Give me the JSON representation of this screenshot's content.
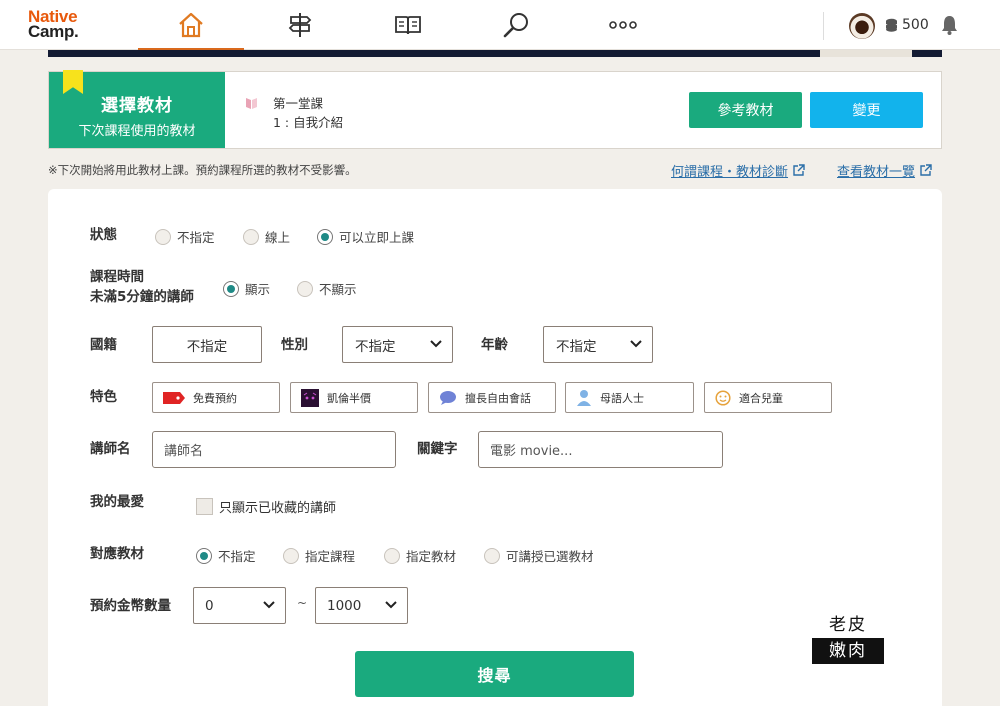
{
  "header": {
    "logo_line1": "Native",
    "logo_line2": "Camp.",
    "nav": [
      {
        "name": "home-icon",
        "active": true
      },
      {
        "name": "signpost-icon",
        "active": false
      },
      {
        "name": "book-icon",
        "active": false
      },
      {
        "name": "search-icon",
        "active": false
      },
      {
        "name": "more-icon",
        "active": false
      }
    ],
    "coins": "500"
  },
  "textbook": {
    "title": "選擇教材",
    "subtitle": "下次課程使用的教材",
    "lesson_line1": "第一堂課",
    "lesson_line2": "1 : 自我介紹",
    "ref_button": "參考教材",
    "change_button": "變更"
  },
  "note": "※下次開始將用此教材上課。預約課程所選的教材不受影響。",
  "links": {
    "diagnosis": "何謂課程・教材診斷",
    "list": "查看教材一覽"
  },
  "form": {
    "status": {
      "label": "狀態",
      "options": [
        "不指定",
        "線上",
        "可以立即上課"
      ],
      "selected": 2
    },
    "short_lesson": {
      "label_line1": "課程時間",
      "label_line2": "未滿5分鐘的講師",
      "options": [
        "顯示",
        "不顯示"
      ],
      "selected": 0
    },
    "nationality": {
      "label": "國籍",
      "value": "不指定"
    },
    "gender": {
      "label": "性別",
      "value": "不指定"
    },
    "age": {
      "label": "年齡",
      "value": "不指定"
    },
    "features": {
      "label": "特色",
      "items": [
        "免費預約",
        "凱倫半價",
        "擅長自由會話",
        "母語人士",
        "適合兒童"
      ]
    },
    "tutor_name": {
      "label": "講師名",
      "placeholder": "講師名"
    },
    "keyword": {
      "label": "關鍵字",
      "placeholder": "電影 movie..."
    },
    "favorite": {
      "label": "我的最愛",
      "checkbox": "只顯示已收藏的講師"
    },
    "material": {
      "label": "對應教材",
      "options": [
        "不指定",
        "指定課程",
        "指定教材",
        "可講授已選教材"
      ],
      "selected": 0
    },
    "coins": {
      "label": "預約金幣數量",
      "min": "0",
      "sep": "~",
      "max": "1000"
    },
    "search_button": "搜尋"
  },
  "watermark": {
    "line1": "老皮",
    "line2": "嫩肉"
  }
}
